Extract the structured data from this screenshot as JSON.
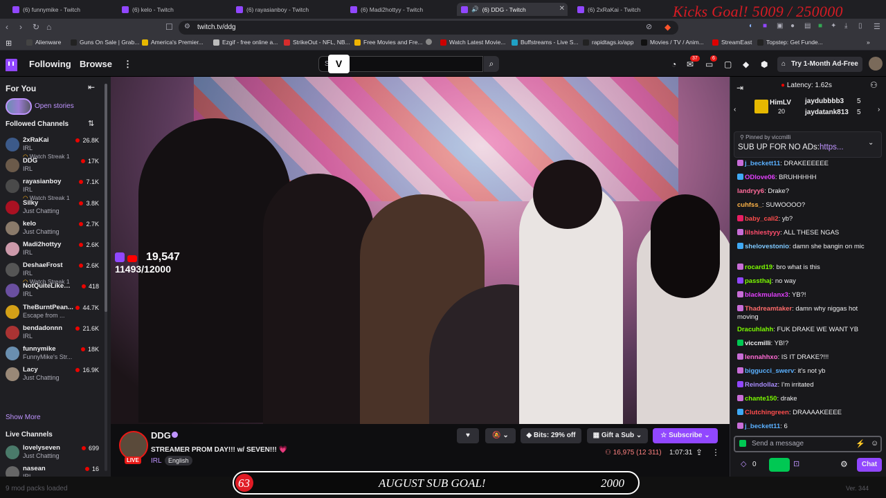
{
  "browser": {
    "tabs": [
      {
        "label": "(6) funnymike - Twitch",
        "active": false
      },
      {
        "label": "(6) kelo - Twitch",
        "active": false
      },
      {
        "label": "(6) rayasianboy - Twitch",
        "active": false
      },
      {
        "label": "(6) Madi2hottyy - Twitch",
        "active": false
      },
      {
        "label": "(6) DDG - Twitch",
        "active": true
      },
      {
        "label": "(6) 2xRaKai - Twitch",
        "active": false
      }
    ],
    "url": "twitch.tv/ddg",
    "bookmarks": [
      {
        "label": "Alienware",
        "color": "#444"
      },
      {
        "label": "Guns On Sale | Grab...",
        "color": "#222"
      },
      {
        "label": "America's Premier...",
        "color": "#e6b800"
      },
      {
        "label": "Ezgif - free online a...",
        "color": "#bbb"
      },
      {
        "label": "StrikeOut - NFL, NB...",
        "color": "#d62c2c"
      },
      {
        "label": "Free Movies and Fre...",
        "color": "#f0b400"
      },
      {
        "label": "Watch Latest Movie...",
        "color": "#c00"
      },
      {
        "label": "Buffstreams - Live S...",
        "color": "#1fa1c5"
      },
      {
        "label": "rapidtags.io/app",
        "color": "#222"
      },
      {
        "label": "Movies / TV / Anim...",
        "color": "#111"
      },
      {
        "label": "StreamEast",
        "color": "#d00"
      },
      {
        "label": "Topstep: Get Funde...",
        "color": "#222"
      }
    ]
  },
  "overlay_kicks": "Kicks Goal! 5009 / 250000",
  "nav": {
    "following": "Following",
    "browse": "Browse",
    "search_placeholder": "S",
    "search_logo": "V",
    "notif_count": "37",
    "inbox_count": "6",
    "ad_free": "Try 1-Month Ad-Free"
  },
  "sidebar": {
    "for_you": "For You",
    "open_stories": "Open stories",
    "followed_header": "Followed Channels",
    "channels": [
      {
        "name": "2xRaKai",
        "category": "IRL",
        "viewers": "26.8K",
        "streak": "Watch Streak 1",
        "color": "#3c5a8a"
      },
      {
        "name": "DDG",
        "category": "IRL",
        "viewers": "17K",
        "streak": "",
        "color": "#6b5a4a"
      },
      {
        "name": "rayasianboy",
        "category": "IRL",
        "viewers": "7.1K",
        "streak": "Watch Streak 1",
        "color": "#4a4a4a"
      },
      {
        "name": "Silky",
        "category": "Just Chatting",
        "viewers": "3.8K",
        "streak": "",
        "color": "#a12"
      },
      {
        "name": "kelo",
        "category": "Just Chatting",
        "viewers": "2.7K",
        "streak": "",
        "color": "#8a7a6a"
      },
      {
        "name": "Madi2hottyy",
        "category": "IRL",
        "viewers": "2.6K",
        "streak": "",
        "color": "#c9a"
      },
      {
        "name": "DeshaeFrost",
        "category": "IRL",
        "viewers": "2.6K",
        "streak": "Watch Streak 1",
        "color": "#555"
      },
      {
        "name": "NotQuiteLikeDuB",
        "category": "IRL",
        "viewers": "418",
        "streak": "",
        "color": "#6a4fa0"
      },
      {
        "name": "TheBurntPean...",
        "category": "Escape from ...",
        "viewers": "44.7K",
        "streak": "",
        "color": "#d4a017"
      },
      {
        "name": "bendadonnn",
        "category": "IRL",
        "viewers": "21.6K",
        "streak": "",
        "color": "#a33"
      },
      {
        "name": "funnymike",
        "category": "FunnyMike's Str...",
        "viewers": "18K",
        "streak": "",
        "color": "#6a8fb0"
      },
      {
        "name": "Lacy",
        "category": "Just Chatting",
        "viewers": "16.9K",
        "streak": "",
        "color": "#998877"
      }
    ],
    "show_more": "Show More",
    "live_header": "Live Channels",
    "live": [
      {
        "name": "lovelyseven",
        "category": "Just Chatting",
        "viewers": "699",
        "color": "#4a7a6a"
      },
      {
        "name": "nasean",
        "category": "IRL",
        "viewers": "16",
        "color": "#666"
      }
    ]
  },
  "video_overlay": {
    "count": "19,547",
    "subs": "11493/12000"
  },
  "stream": {
    "channel": "DDG",
    "title": "STREAMER PROM DAY!!! w/ SEVEN!!! 💗",
    "live_label": "LIVE",
    "category": "IRL",
    "tag": "English",
    "bits": "Bits: 29% off",
    "gift": "Gift a Sub",
    "subscribe": "Subscribe",
    "viewers": "16,975 (12 311)",
    "uptime": "1:07:31"
  },
  "sub_goal": {
    "left": "63",
    "title": "AUGUST SUB GOAL!",
    "right": "2000"
  },
  "footer": {
    "left": "9 mod packs loaded",
    "right": "Ver. 344"
  },
  "chat": {
    "latency": "Latency: 1.62s",
    "gifter": "HimLV",
    "gifter_count": "20",
    "top1": {
      "name": "jaydubbbb3",
      "count": "5"
    },
    "top2": {
      "name": "jaydatank813",
      "count": "5"
    },
    "pinned_by": "Pinned by",
    "pinned_user": "viccmilli",
    "pinned_text": "SUB UP FOR NO ADs:",
    "pinned_link": "https...",
    "messages": [
      {
        "user": "j_beckett11",
        "text": "DRAKEEEEEE",
        "color": "#5ab0ff",
        "badge": "#c86dd7"
      },
      {
        "user": "ODlove06",
        "text": "BRUHHHHH",
        "color": "#e040fb",
        "badge": "#3fa9f5"
      },
      {
        "user": "landryy6",
        "text": "Drake?",
        "color": "#ff6b9a",
        "badge": ""
      },
      {
        "user": "cuhfss_",
        "text": "SUWOOOO?",
        "color": "#ffb347",
        "badge": ""
      },
      {
        "user": "baby_cali2",
        "text": "yb?",
        "color": "#ff4d4d",
        "badge": "#e91e63"
      },
      {
        "user": "lilshiestyyy",
        "text": "ALL THESE NGAS",
        "color": "#ff4d6d",
        "badge": "#c86dd7"
      },
      {
        "user": "shelovestonio",
        "text": "damn she bangin on mic",
        "color": "#7ec8ff",
        "badge": "#3fa9f5"
      },
      {
        "user": "rocard19",
        "text": "bro what is this",
        "color": "#7cfc00",
        "badge": "#c86dd7"
      },
      {
        "user": "passthaj",
        "text": "no way",
        "color": "#7cfc00",
        "badge": "#9147ff"
      },
      {
        "user": "blackmulanx3",
        "text": "YB?!",
        "color": "#e040fb",
        "badge": "#c86dd7"
      },
      {
        "user": "Thadreamtaker",
        "text": "damn why niggas hot moving",
        "color": "#ff6b6b",
        "badge": "#c86dd7"
      },
      {
        "user": "Dracuhlahh",
        "text": "FUK DRAKE WE WANT YB",
        "color": "#7cfc00",
        "badge": ""
      },
      {
        "user": "viccmilli",
        "text": "YB!?",
        "color": "#efeff1",
        "badge": "#00c853"
      },
      {
        "user": "lennahhxo",
        "text": "IS IT DRAKE?!!!",
        "color": "#ff6bd5",
        "badge": "#c86dd7"
      },
      {
        "user": "biggucci_swerv",
        "text": "it's not yb",
        "color": "#5ab0ff",
        "badge": "#c86dd7"
      },
      {
        "user": "Reindollaz",
        "text": "I'm irritated",
        "color": "#a78bfa",
        "badge": "#9147ff"
      },
      {
        "user": "chante150",
        "text": "drake",
        "color": "#7cfc00",
        "badge": "#c86dd7"
      },
      {
        "user": "Clutchingreen",
        "text": "DRAAAAKEEEE",
        "color": "#ff4d4d",
        "badge": "#3fa9f5"
      },
      {
        "user": "j_beckett11",
        "text": "6",
        "color": "#5ab0ff",
        "badge": "#c86dd7"
      }
    ],
    "input_placeholder": "Send a message",
    "points": "0",
    "chat_button": "Chat"
  }
}
